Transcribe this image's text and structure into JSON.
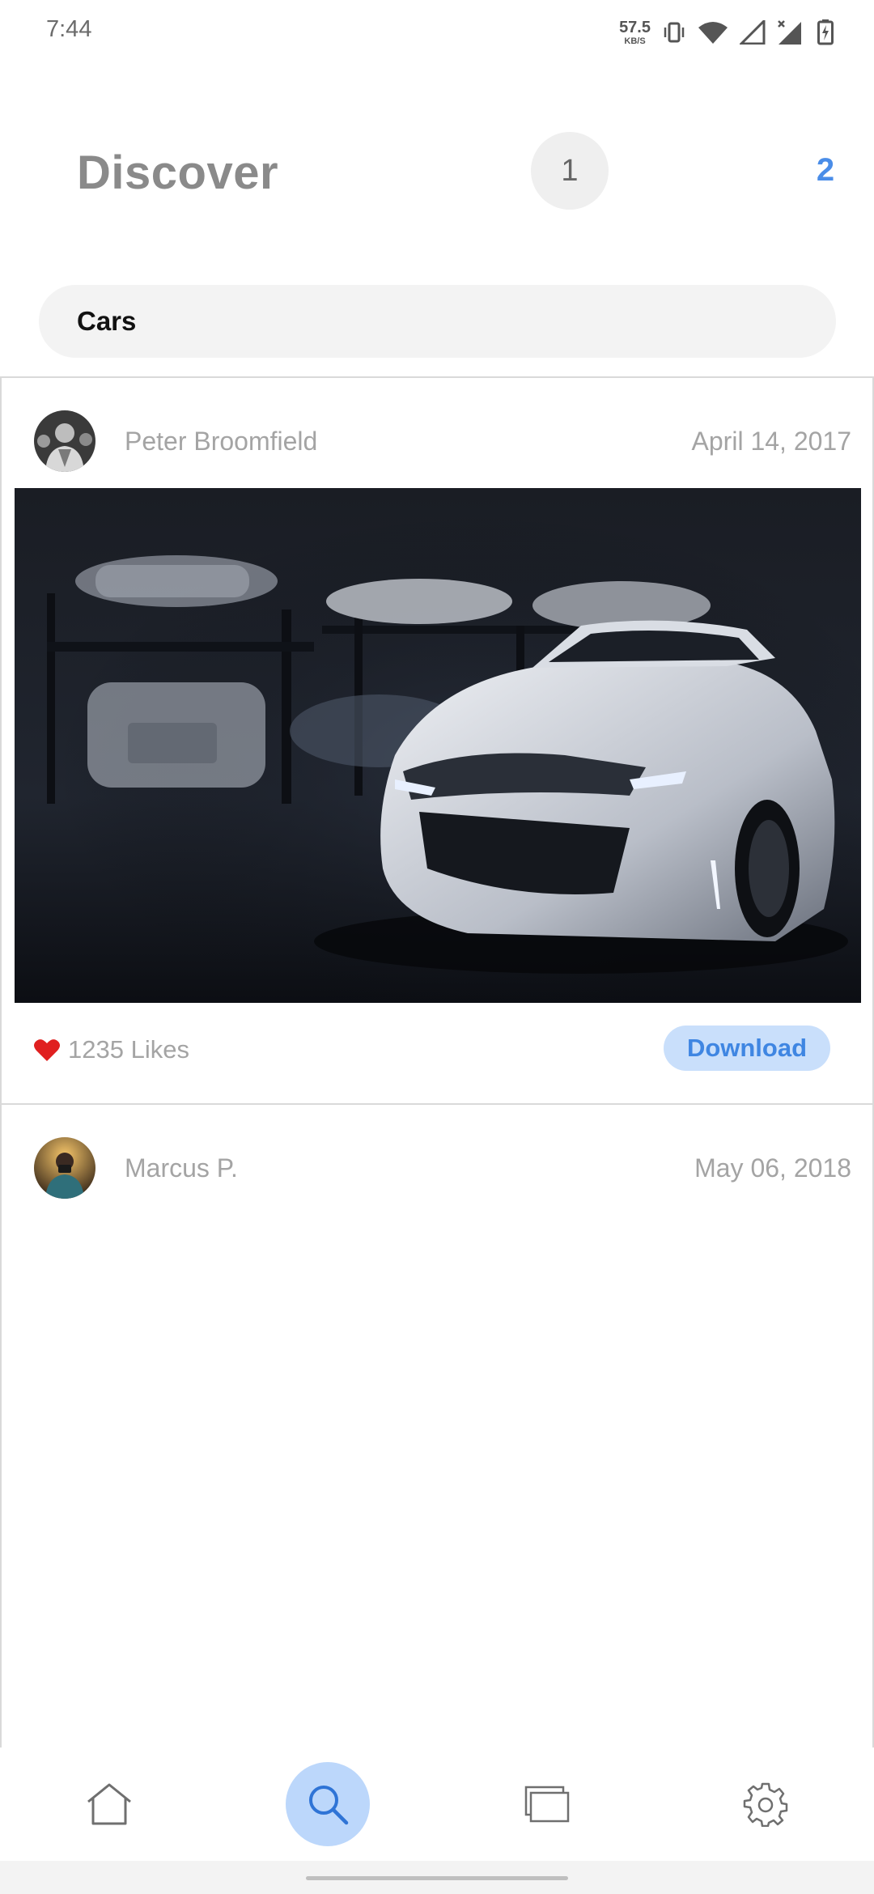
{
  "status_bar": {
    "time": "7:44",
    "net_speed_value": "57.5",
    "net_speed_unit": "KB/S",
    "icons": [
      "vibrate-icon",
      "wifi-icon",
      "signal-icon",
      "signal-no-data-icon",
      "battery-charging-icon"
    ]
  },
  "header": {
    "title": "Discover",
    "page_1_label": "1",
    "page_2_label": "2"
  },
  "search": {
    "value": "Cars"
  },
  "posts": [
    {
      "author": "Peter Broomfield",
      "date": "April 14, 2017",
      "likes_label": "1235 Likes",
      "download_label": "Download"
    },
    {
      "author": "Marcus P.",
      "date": "May 06, 2018"
    }
  ],
  "bottom_nav": {
    "items": [
      "home-icon",
      "search-icon",
      "collections-icon",
      "settings-icon"
    ],
    "active": "search-icon"
  },
  "colors": {
    "accent": "#4a8de8",
    "accent_light": "#c9dffb",
    "like_red": "#e02020",
    "muted_text": "#a4a4a4"
  }
}
